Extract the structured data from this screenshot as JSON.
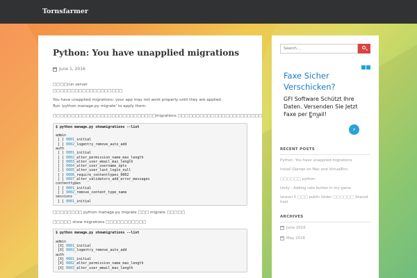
{
  "site": {
    "brand": "Tornsfarmer"
  },
  "post": {
    "title": "Python: You have unapplied migrations",
    "date": "June 1, 2016",
    "paragraphs_top": [
      "□□□□run server",
      "□□□□□□□□□□□□□□□□□□□",
      "You have unapplied migrations; your app may not work properly until they are applied.",
      "Run 'python manage.py migrate' to apply them.",
      "□□□□□□□□□□□□□□□□□□□□□□□□□□□□migrations □□□□□□□□□□□□□□□□□□□□□□□"
    ],
    "code1": {
      "command": "$ python manage.py showmigrations --list",
      "lines": [
        "",
        "admin",
        " [ ] 0001_initial",
        " [ ] 0002_logentry_remove_auto_add",
        "auth",
        " [ ] 0001_initial",
        " [ ] 0002_alter_permission_name_max_length",
        " [ ] 0003_alter_user_email_max_length",
        " [ ] 0004_alter_user_username_opts",
        " [ ] 0005_alter_user_last_login_null",
        " [ ] 0006_require_contenttypes_0002",
        " [ ] 0007_alter_validators_add_error_messages",
        "contenttypes",
        " [ ] 0001_initial",
        " [ ] 0002_remove_content_type_name",
        "sessions",
        " [ ] 0001_initial"
      ]
    },
    "paragraphs_mid": [
      "□□□□□□□□ python manage.py migrate □□□ migrate □□□□□",
      "□□□□□ show migrations □□□□□□□□□□□"
    ],
    "code2": {
      "command": "$ python manage.py showmigrations --list",
      "lines": [
        "",
        "admin",
        " [X] 0001_initial",
        " [X] 0002_logentry_remove_auto_add",
        "auth",
        " [X] 0001_initial",
        " [X] 0002_alter_permission_name_max_length",
        " [X] 0003_alter_user_email_max_length"
      ]
    }
  },
  "sidebar": {
    "search": {
      "placeholder": "Search..."
    },
    "ad": {
      "headline_1": "Faxe Sicher",
      "headline_2": "Verschicken?",
      "body_1": "GFI Software Schützt Ihre",
      "body_2": "Daten. Versenden Sie Jetzt",
      "body_3": "Faxe per Email!",
      "arrow": "›"
    },
    "recent_posts": {
      "title": "RECENT POSTS",
      "items": [
        "Python: You have unapplied migrations",
        "Install Django on Mac and VirtualEnv",
        "□□□□□□ python",
        "Unity : Adding rate button in my game",
        "laravel 5 □□□ public folder □□□□□□ Shared",
        "host"
      ]
    },
    "archives": {
      "title": "ARCHIVES",
      "items": [
        "June 2016",
        "May 2016"
      ]
    }
  }
}
